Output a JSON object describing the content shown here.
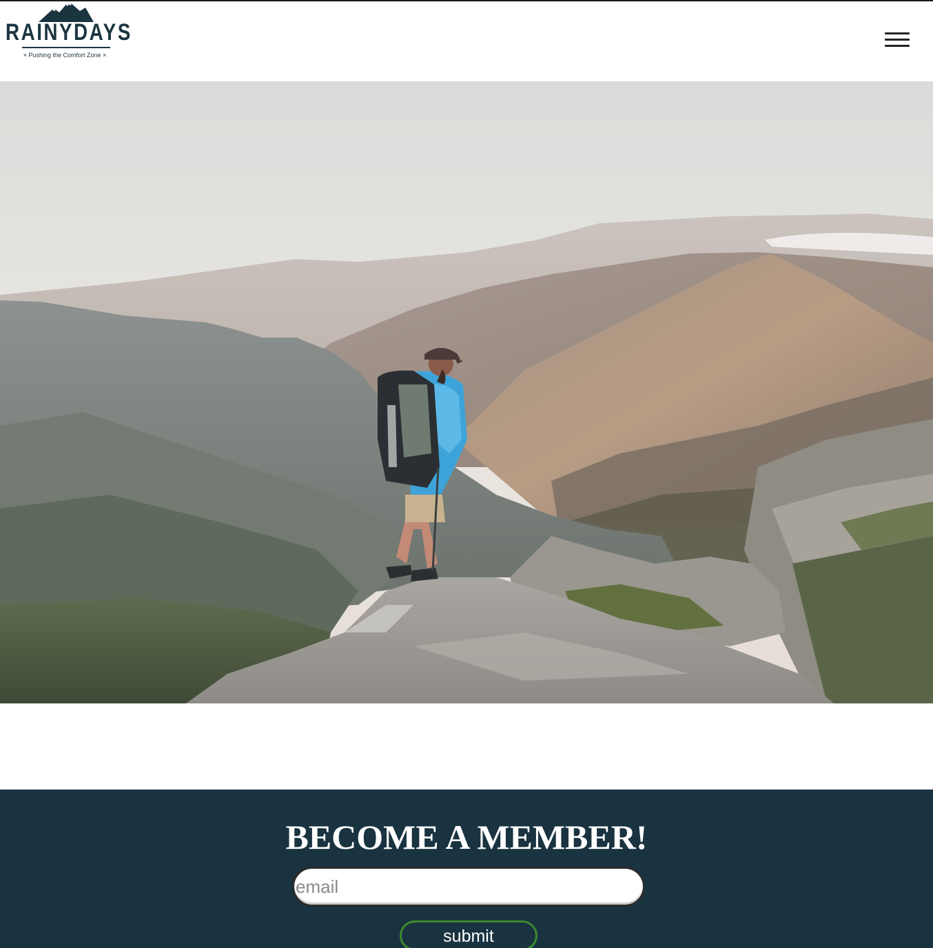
{
  "header": {
    "logo": {
      "brand": "RAINYDAYS",
      "tagline": "Pushing the Comfort Zone",
      "tagline_mark": "×"
    },
    "menu_icon": "hamburger-menu-icon"
  },
  "hero": {
    "image": "hiker-on-mountain-ridge-photo"
  },
  "membership": {
    "title": "BECOME A MEMBER!",
    "email_placeholder": "email",
    "email_value": "",
    "submit_label": "submit"
  },
  "colors": {
    "brand": "#1b3540",
    "member_background": "#193340",
    "submit_border": "#3f8a2e"
  }
}
